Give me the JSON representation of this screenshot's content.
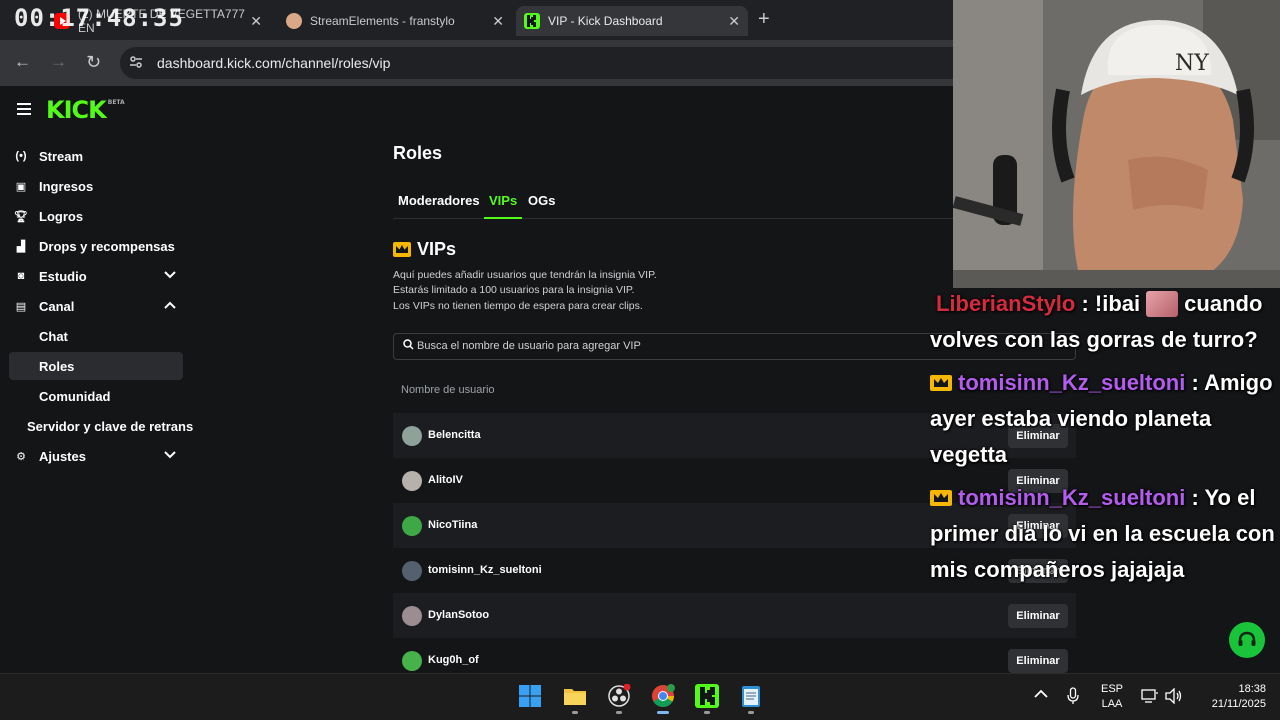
{
  "browser": {
    "timer_overlay": "00:17:48:35",
    "tabs": [
      {
        "title": "(2) MUERTE DE VEGETTA777 EN",
        "icon": "youtube-icon",
        "color": "#ff0000"
      },
      {
        "title": "StreamElements - franstylo",
        "icon": "streamelements-icon",
        "color": "#d9a889"
      },
      {
        "title": "VIP - Kick Dashboard",
        "icon": "kick-icon",
        "color": "#53fc18"
      }
    ],
    "url": "dashboard.kick.com/channel/roles/vip"
  },
  "kick": {
    "logo": "KICK",
    "logo_badge": "BETA",
    "accent": "#53fc18"
  },
  "sidebar": {
    "items": [
      {
        "label": "Stream",
        "icon": "broadcast-icon"
      },
      {
        "label": "Ingresos",
        "icon": "revenue-icon"
      },
      {
        "label": "Logros",
        "icon": "trophy-icon"
      },
      {
        "label": "Drops y recompensas",
        "icon": "gift-icon"
      },
      {
        "label": "Estudio",
        "icon": "studio-icon"
      },
      {
        "label": "Canal",
        "icon": "channel-icon"
      },
      {
        "label": "Chat"
      },
      {
        "label": "Roles"
      },
      {
        "label": "Comunidad"
      },
      {
        "label": "Servidor y clave de retrans"
      },
      {
        "label": "Ajustes",
        "icon": "gear-icon"
      }
    ]
  },
  "main": {
    "title": "Roles",
    "tabs": [
      "Moderadores",
      "VIPs",
      "OGs"
    ],
    "active_tab": "VIPs",
    "section_title": "VIPs",
    "desc": [
      "Aquí puedes añadir usuarios que tendrán la insignia VIP.",
      "Estarás limitado a 100 usuarios para la insignia VIP.",
      "Los VIPs no tienen tiempo de espera para crear clips."
    ],
    "search_placeholder": "Busca el nombre de usuario para agregar VIP",
    "column_header": "Nombre de usuario",
    "delete_label": "Eliminar",
    "users": [
      {
        "name": "Belencitta",
        "avatar_color": "#8fa29a"
      },
      {
        "name": "AlitoIV",
        "avatar_color": "#b7b1ac"
      },
      {
        "name": "NicoTiina",
        "avatar_color": "#3ea846"
      },
      {
        "name": "tomisinn_Kz_sueltoni",
        "avatar_color": "#55606e"
      },
      {
        "name": "DylanSotoo",
        "avatar_color": "#9b8d92"
      },
      {
        "name": "Kug0h_of",
        "avatar_color": "#47b14c"
      }
    ]
  },
  "stream_chat": [
    {
      "user": "LiberianStylo",
      "user_color": "#d62a3e",
      "sep": " : ",
      "text_before": "!ibai",
      "emote": true,
      "text_after": "cuando volves con las gorras de turro?",
      "badge": false
    },
    {
      "user": "tomisinn_Kz_sueltoni",
      "user_color": "#b45cf0",
      "sep": " : ",
      "text_before": "",
      "emote": false,
      "text_after": "Amigo ayer estaba viendo planeta vegetta",
      "badge": true
    },
    {
      "user": "tomisinn_Kz_sueltoni",
      "user_color": "#b45cf0",
      "sep": " : ",
      "text_before": "",
      "emote": false,
      "text_after": "Yo el primer dia lo vi en la escuela con mis compañeros jajajaja",
      "badge": true
    }
  ],
  "taskbar": {
    "lang": "ESP",
    "layout": "LAA",
    "time": "18:38",
    "date": "21/11/2025"
  }
}
